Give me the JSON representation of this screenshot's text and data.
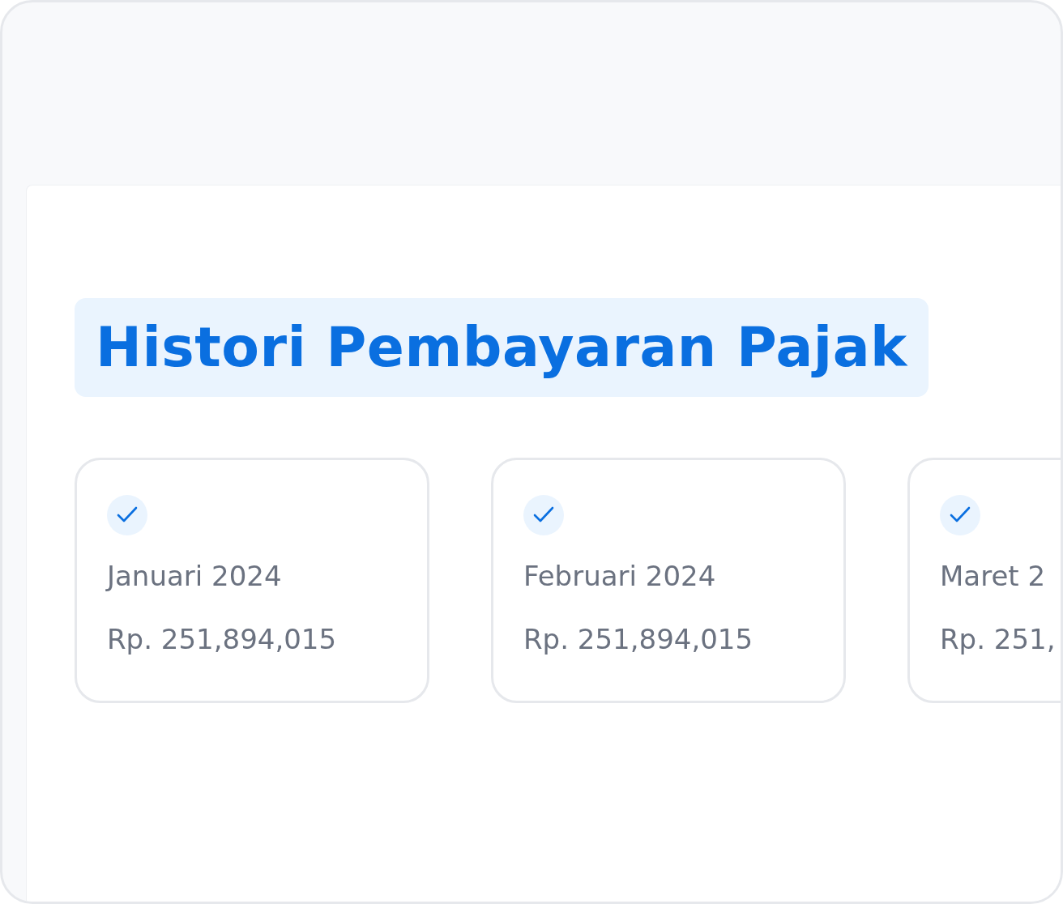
{
  "title": "Histori Pembayaran Pajak",
  "payments": [
    {
      "month": "Januari 2024",
      "amount": "Rp. 251,894,015",
      "checked": true
    },
    {
      "month": "Februari 2024",
      "amount": "Rp. 251,894,015",
      "checked": true
    },
    {
      "month": "Maret 2",
      "amount": "Rp. 251,",
      "checked": true
    }
  ]
}
